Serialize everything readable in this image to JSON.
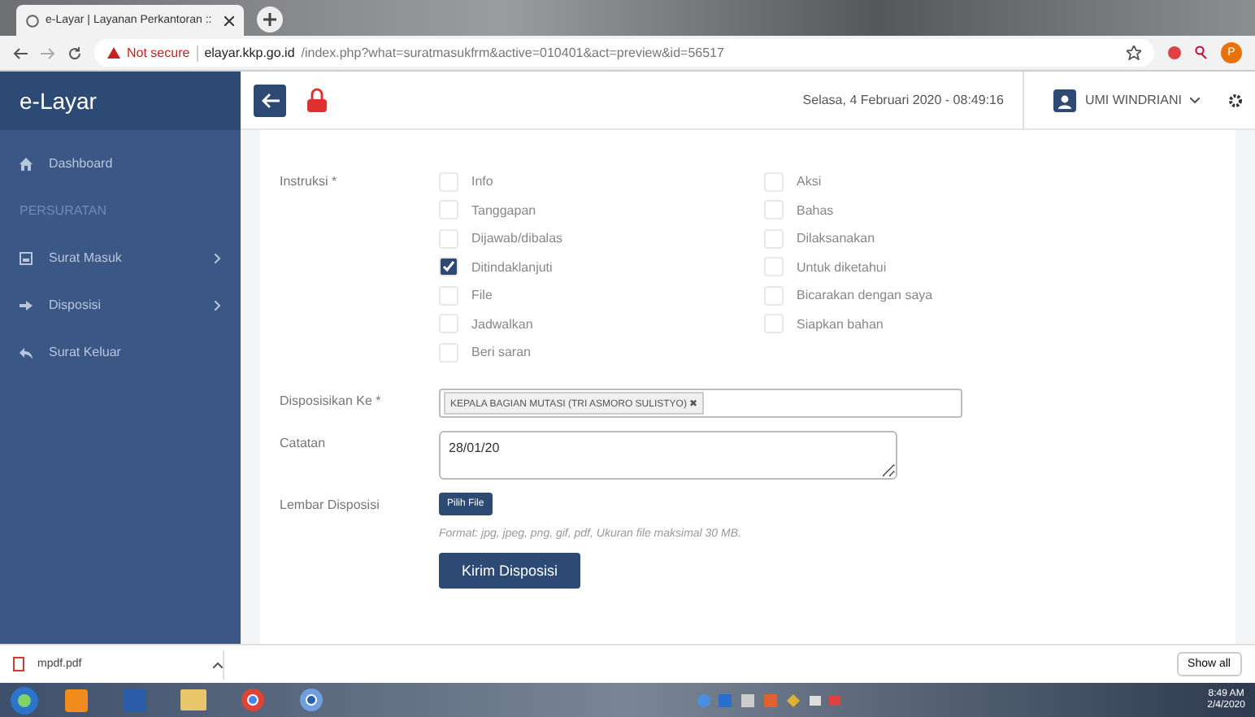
{
  "browser": {
    "tab_title": "e-Layar | Layanan Perkantoran :: ",
    "security": "Not secure",
    "url_host": "elayar.kkp.go.id",
    "url_path": "/index.php?what=suratmasukfrm&active=010401&act=preview&id=56517",
    "profile": "P"
  },
  "app": {
    "brand": "e-Layar",
    "datetime": "Selasa, 4 Februari 2020 - 08:49:16",
    "user": "UMI WINDRIANI"
  },
  "sidebar": [
    {
      "kind": "item",
      "label": "Dashboard",
      "submenu": false
    },
    {
      "kind": "section",
      "label": "PERSURATAN"
    },
    {
      "kind": "item",
      "label": "Surat Masuk",
      "submenu": true
    },
    {
      "kind": "item",
      "label": "Disposisi",
      "submenu": true
    },
    {
      "kind": "item",
      "label": "Surat Keluar",
      "submenu": false
    }
  ],
  "form": {
    "instruksi_label": "Instruksi *",
    "options_left": [
      {
        "label": "Info",
        "checked": false
      },
      {
        "label": "Tanggapan",
        "checked": false
      },
      {
        "label": "Dijawab/dibalas",
        "checked": false
      },
      {
        "label": "Ditindaklanjuti",
        "checked": true
      },
      {
        "label": "File",
        "checked": false
      },
      {
        "label": "Jadwalkan",
        "checked": false
      },
      {
        "label": "Beri saran",
        "checked": false
      }
    ],
    "options_right": [
      {
        "label": "Aksi",
        "checked": false
      },
      {
        "label": "Bahas",
        "checked": false
      },
      {
        "label": "Dilaksanakan",
        "checked": false
      },
      {
        "label": "Untuk diketahui",
        "checked": false
      },
      {
        "label": "Bicarakan dengan saya",
        "checked": false
      },
      {
        "label": "Siapkan bahan",
        "checked": false
      }
    ],
    "disposisi_label": "Disposisikan Ke *",
    "disposisi_tags": [
      {
        "label": "KEPALA BAGIAN MUTASI (TRI ASMORO SULISTYO)",
        "remove": "✖"
      }
    ],
    "catatan_label": "Catatan",
    "catatan_value": "28/01/20",
    "lembar_label": "Lembar Disposisi",
    "file_button": "Pilih File",
    "file_hint": "Format: jpg, jpeg, png, gif, pdf, Ukuran file maksimal 30 MB.",
    "submit": "Kirim Disposisi"
  },
  "downloads": {
    "file": "mpdf.pdf",
    "show_all": "Show all"
  },
  "taskbar": {
    "time": "8:49 AM",
    "date": "2/4/2020"
  }
}
